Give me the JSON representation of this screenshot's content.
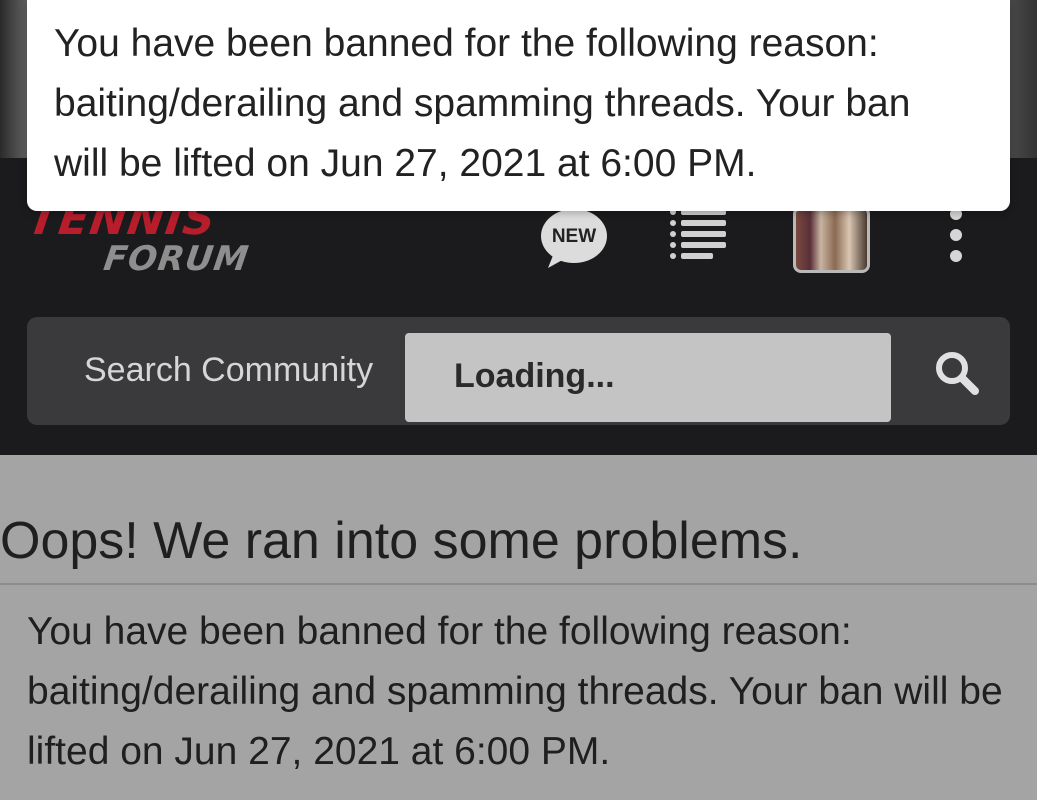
{
  "toast": {
    "message": "You have been banned for the following reason: baiting/derailing and spamming threads. Your ban will be lifted on Jun 27, 2021 at 6:00 PM."
  },
  "header": {
    "logo_line1": "TENNIS",
    "logo_line2": "FORUM",
    "new_badge_label": "NEW",
    "icons": [
      "new-posts-icon",
      "list-icon",
      "avatar",
      "more-vertical-icon"
    ]
  },
  "search": {
    "placeholder": "Search Community",
    "loading_label": "Loading..."
  },
  "error": {
    "title": "Oops! We ran into some problems.",
    "message": "You have been banned for the following reason: baiting/derailing and spamming threads. Your ban will be lifted on Jun 27, 2021 at 6:00 PM."
  },
  "colors": {
    "header_bg": "#1b1b1d",
    "search_bg": "#3a3a3c",
    "logo_red": "#b81d2b",
    "overlay_gray": "#a4a4a4"
  }
}
